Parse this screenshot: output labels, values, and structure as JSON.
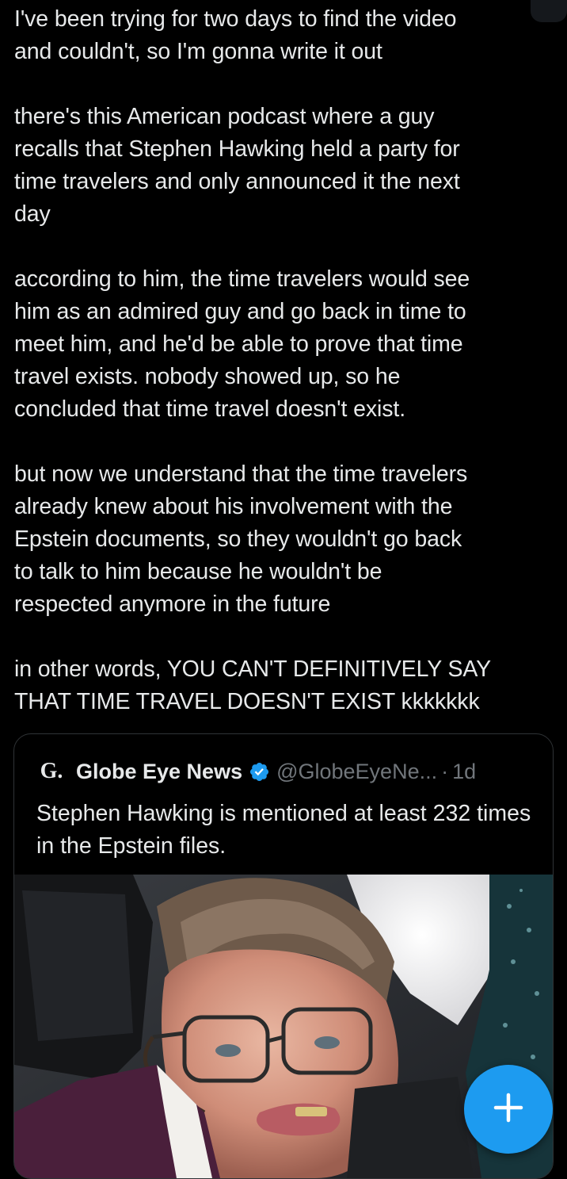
{
  "tweet": {
    "paragraphs": [
      "I've been trying for two days to find the video\nand couldn't, so I'm gonna write it out",
      "there's this American podcast where a guy\nrecalls that Stephen Hawking held a party for\ntime travelers and only announced it the next\nday",
      "according to him, the time travelers would see\nhim as an admired guy and go back in time to\nmeet him, and he'd be able to prove that time\ntravel exists. nobody showed up, so he\nconcluded that time travel doesn't exist.",
      "but now we understand that the time travelers\nalready knew about his involvement with the\nEpstein documents, so they wouldn't go back\nto talk to him because he wouldn't be\nrespected anymore in the future",
      "in other words, YOU CAN'T DEFINITIVELY SAY\nTHAT TIME TRAVEL DOESN'T EXIST kkkkkkk"
    ]
  },
  "quoted_post": {
    "source_logo": "G.",
    "source_name": "Globe Eye News",
    "verified_icon": "verified-badge-icon",
    "handle": "@GlobeEyeNe...",
    "separator": "·",
    "time": "1d",
    "text": "Stephen Hawking is mentioned at least 232 times in the Epstein files.",
    "image_alt": "Stephen Hawking photo"
  },
  "compose_button": {
    "icon": "plus-icon",
    "color": "#1d9bf0"
  },
  "colors": {
    "background": "#000000",
    "text_primary": "#e7e9ea",
    "text_secondary": "#71767b",
    "accent": "#1d9bf0",
    "card_border": "#2f3336"
  }
}
